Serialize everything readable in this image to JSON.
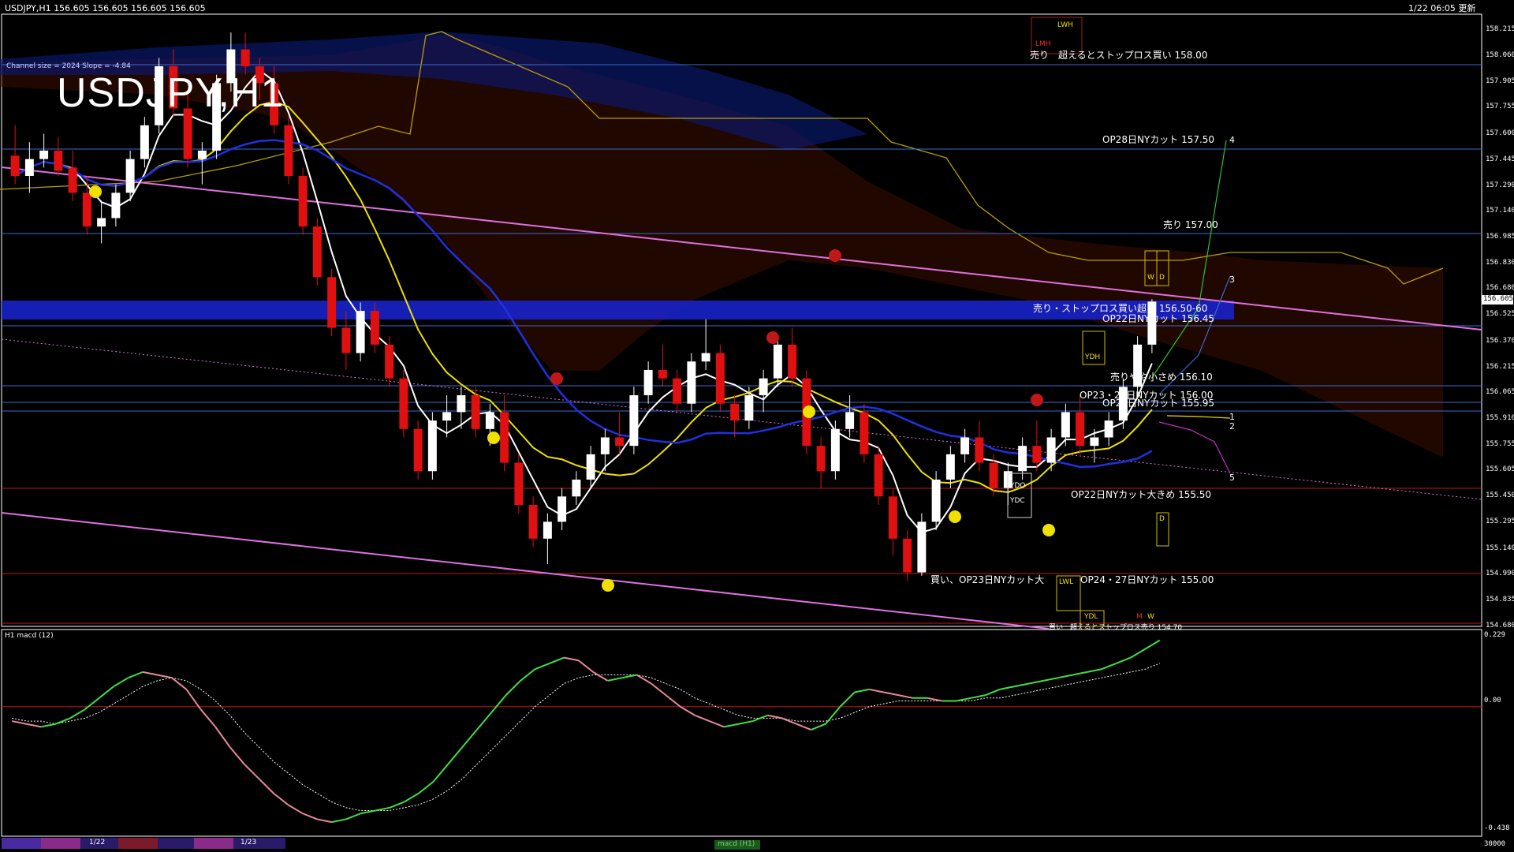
{
  "header": {
    "symbol_info": "USDJPY,H1  156.605 156.605 156.605 156.605",
    "chart_title": "USDJPY,H1",
    "datetime": "1/22 06:05 更新",
    "channel_info": "Channel size = 2024 Slope = -4.84"
  },
  "price_axis": {
    "ticks": [
      "158.215",
      "158.060",
      "157.905",
      "157.755",
      "157.600",
      "157.445",
      "157.290",
      "157.140",
      "156.985",
      "156.830",
      "156.680",
      "156.525",
      "156.370",
      "156.215",
      "156.065",
      "155.910",
      "155.755",
      "155.605",
      "155.450",
      "155.295",
      "155.140",
      "154.990",
      "154.835",
      "154.680"
    ],
    "current_price": "156.605"
  },
  "levels": [
    {
      "text": "売り　超えるとストップロス買い 158.00"
    },
    {
      "text": "OP28日NYカット 157.50"
    },
    {
      "text": "売り 157.00"
    },
    {
      "text": "売り・ストップロス買い超え 156.50-60"
    },
    {
      "text": "OP22日NYカット 156.45"
    },
    {
      "text": "売りやや小さめ 156.10"
    },
    {
      "text": "OP23・27日NYカット 156.00"
    },
    {
      "text": "OP27日NYカット 155.95"
    },
    {
      "text": "OP22日NYカット大きめ 155.50"
    },
    {
      "text": "買い、OP23日NYカット大"
    },
    {
      "text": "OP24・27日NYカット 155.00"
    },
    {
      "text": "買い　超えるとストップロス売り 154.70"
    }
  ],
  "tags": {
    "lwh": "LWH",
    "lmh": "LMH",
    "w1": "W",
    "d1": "D",
    "ydh": "YDH",
    "ydo": "YDO",
    "ydc": "YDC",
    "d2": "D",
    "lwl": "LWL",
    "ydl": "YDL",
    "m": "M",
    "w2": "W"
  },
  "wave_labels": [
    "4",
    "3",
    "1",
    "2",
    "5"
  ],
  "macd": {
    "label": "H1  macd (12)",
    "ticks": [
      "0.229",
      "0.00",
      "-0.438"
    ]
  },
  "bottom_bar": {
    "dates": [
      "1/22",
      "1/23"
    ],
    "indicator_name": "macd (H1)",
    "right_value": "30000"
  },
  "chart_data": {
    "type": "candlestick",
    "title": "USDJPY H1",
    "ylim": [
      154.68,
      158.215
    ],
    "macd_ylim": [
      -0.438,
      0.229
    ],
    "candles": [
      [
        157.47,
        157.65,
        157.3,
        157.35
      ],
      [
        157.35,
        157.55,
        157.25,
        157.45
      ],
      [
        157.45,
        157.6,
        157.4,
        157.5
      ],
      [
        157.5,
        157.58,
        157.35,
        157.38
      ],
      [
        157.4,
        157.5,
        157.2,
        157.25
      ],
      [
        157.25,
        157.35,
        157.0,
        157.05
      ],
      [
        157.05,
        157.2,
        156.95,
        157.1
      ],
      [
        157.1,
        157.3,
        157.05,
        157.25
      ],
      [
        157.25,
        157.5,
        157.2,
        157.45
      ],
      [
        157.45,
        157.7,
        157.4,
        157.65
      ],
      [
        157.65,
        158.05,
        157.6,
        158.0
      ],
      [
        158.0,
        158.1,
        157.7,
        157.75
      ],
      [
        157.75,
        157.85,
        157.4,
        157.45
      ],
      [
        157.45,
        157.55,
        157.3,
        157.5
      ],
      [
        157.5,
        157.95,
        157.45,
        157.9
      ],
      [
        157.9,
        158.2,
        157.85,
        158.1
      ],
      [
        158.1,
        158.2,
        157.95,
        158.0
      ],
      [
        158.0,
        158.05,
        157.8,
        157.9
      ],
      [
        157.9,
        158.0,
        157.6,
        157.65
      ],
      [
        157.65,
        157.7,
        157.3,
        157.35
      ],
      [
        157.35,
        157.4,
        157.0,
        157.05
      ],
      [
        157.05,
        157.1,
        156.7,
        156.75
      ],
      [
        156.75,
        156.8,
        156.4,
        156.45
      ],
      [
        156.45,
        156.55,
        156.2,
        156.3
      ],
      [
        156.3,
        156.6,
        156.25,
        156.55
      ],
      [
        156.55,
        156.6,
        156.3,
        156.35
      ],
      [
        156.35,
        156.4,
        156.1,
        156.15
      ],
      [
        156.15,
        156.2,
        155.8,
        155.85
      ],
      [
        155.85,
        155.9,
        155.55,
        155.6
      ],
      [
        155.6,
        155.95,
        155.55,
        155.9
      ],
      [
        155.9,
        156.05,
        155.8,
        155.95
      ],
      [
        155.95,
        156.1,
        155.85,
        156.05
      ],
      [
        156.05,
        156.1,
        155.8,
        155.85
      ],
      [
        155.85,
        156.0,
        155.75,
        155.95
      ],
      [
        155.95,
        156.05,
        155.6,
        155.65
      ],
      [
        155.65,
        155.7,
        155.35,
        155.4
      ],
      [
        155.4,
        155.45,
        155.15,
        155.2
      ],
      [
        155.2,
        155.35,
        155.05,
        155.3
      ],
      [
        155.3,
        155.5,
        155.25,
        155.45
      ],
      [
        155.45,
        155.6,
        155.4,
        155.55
      ],
      [
        155.55,
        155.75,
        155.5,
        155.7
      ],
      [
        155.7,
        155.85,
        155.6,
        155.8
      ],
      [
        155.8,
        155.95,
        155.7,
        155.75
      ],
      [
        155.75,
        156.1,
        155.7,
        156.05
      ],
      [
        156.05,
        156.25,
        156.0,
        156.2
      ],
      [
        156.2,
        156.35,
        156.1,
        156.15
      ],
      [
        156.15,
        156.2,
        155.95,
        156.0
      ],
      [
        156.0,
        156.3,
        155.95,
        156.25
      ],
      [
        156.25,
        156.5,
        156.2,
        156.3
      ],
      [
        156.3,
        156.35,
        155.95,
        156.0
      ],
      [
        156.0,
        156.05,
        155.8,
        155.9
      ],
      [
        155.9,
        156.1,
        155.85,
        156.05
      ],
      [
        156.05,
        156.2,
        155.95,
        156.15
      ],
      [
        156.15,
        156.4,
        156.1,
        156.35
      ],
      [
        156.35,
        156.45,
        156.1,
        156.15
      ],
      [
        156.15,
        156.2,
        155.7,
        155.75
      ],
      [
        155.75,
        155.8,
        155.5,
        155.6
      ],
      [
        155.6,
        155.9,
        155.55,
        155.85
      ],
      [
        155.85,
        156.05,
        155.8,
        155.95
      ],
      [
        155.95,
        156.0,
        155.65,
        155.7
      ],
      [
        155.7,
        155.75,
        155.4,
        155.45
      ],
      [
        155.45,
        155.5,
        155.1,
        155.2
      ],
      [
        155.2,
        155.25,
        154.95,
        155.0
      ],
      [
        155.0,
        155.35,
        154.98,
        155.3
      ],
      [
        155.3,
        155.6,
        155.25,
        155.55
      ],
      [
        155.55,
        155.75,
        155.5,
        155.7
      ],
      [
        155.7,
        155.85,
        155.65,
        155.8
      ],
      [
        155.8,
        155.9,
        155.6,
        155.65
      ],
      [
        155.65,
        155.7,
        155.45,
        155.5
      ],
      [
        155.5,
        155.65,
        155.4,
        155.6
      ],
      [
        155.6,
        155.8,
        155.55,
        155.75
      ],
      [
        155.75,
        155.9,
        155.6,
        155.65
      ],
      [
        155.65,
        155.85,
        155.6,
        155.8
      ],
      [
        155.8,
        156.0,
        155.75,
        155.95
      ],
      [
        155.95,
        156.05,
        155.7,
        155.75
      ],
      [
        155.75,
        155.85,
        155.65,
        155.8
      ],
      [
        155.8,
        155.95,
        155.75,
        155.9
      ],
      [
        155.9,
        156.15,
        155.85,
        156.1
      ],
      [
        156.1,
        156.4,
        156.05,
        156.35
      ],
      [
        156.35,
        156.62,
        156.3,
        156.605
      ]
    ],
    "macd_line": [
      -0.05,
      -0.06,
      -0.07,
      -0.06,
      -0.04,
      -0.01,
      0.03,
      0.07,
      0.1,
      0.12,
      0.11,
      0.1,
      0.06,
      -0.01,
      -0.07,
      -0.14,
      -0.2,
      -0.25,
      -0.3,
      -0.34,
      -0.37,
      -0.39,
      -0.4,
      -0.39,
      -0.37,
      -0.36,
      -0.35,
      -0.33,
      -0.3,
      -0.26,
      -0.2,
      -0.14,
      -0.08,
      -0.02,
      0.04,
      0.09,
      0.13,
      0.15,
      0.17,
      0.16,
      0.12,
      0.09,
      0.1,
      0.11,
      0.08,
      0.04,
      0.0,
      -0.03,
      -0.05,
      -0.07,
      -0.06,
      -0.05,
      -0.03,
      -0.04,
      -0.06,
      -0.08,
      -0.06,
      0.0,
      0.05,
      0.06,
      0.05,
      0.04,
      0.03,
      0.03,
      0.02,
      0.02,
      0.03,
      0.04,
      0.06,
      0.07,
      0.08,
      0.09,
      0.1,
      0.11,
      0.12,
      0.13,
      0.15,
      0.17,
      0.2,
      0.23
    ],
    "signal_line": [
      -0.04,
      -0.05,
      -0.05,
      -0.06,
      -0.05,
      -0.04,
      -0.02,
      0.01,
      0.04,
      0.07,
      0.09,
      0.1,
      0.09,
      0.06,
      0.02,
      -0.03,
      -0.09,
      -0.14,
      -0.19,
      -0.23,
      -0.27,
      -0.3,
      -0.33,
      -0.35,
      -0.36,
      -0.36,
      -0.36,
      -0.35,
      -0.34,
      -0.32,
      -0.29,
      -0.25,
      -0.2,
      -0.15,
      -0.1,
      -0.05,
      0.0,
      0.04,
      0.08,
      0.1,
      0.11,
      0.11,
      0.11,
      0.11,
      0.1,
      0.08,
      0.06,
      0.03,
      0.01,
      -0.01,
      -0.03,
      -0.04,
      -0.04,
      -0.04,
      -0.05,
      -0.05,
      -0.05,
      -0.04,
      -0.02,
      0.0,
      0.01,
      0.02,
      0.02,
      0.02,
      0.02,
      0.02,
      0.02,
      0.03,
      0.03,
      0.04,
      0.05,
      0.06,
      0.07,
      0.08,
      0.09,
      0.1,
      0.11,
      0.12,
      0.13,
      0.15
    ]
  }
}
